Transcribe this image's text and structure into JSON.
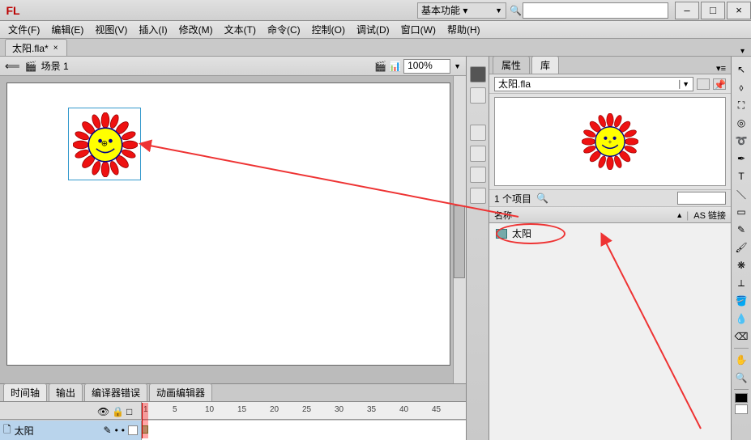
{
  "titlebar": {
    "logo": "FL",
    "workspace": "基本功能 ▾",
    "search_placeholder": "",
    "btn_min": "–",
    "btn_max": "□",
    "btn_close": "×"
  },
  "menu": {
    "file": "文件(F)",
    "edit": "编辑(E)",
    "view": "视图(V)",
    "insert": "插入(I)",
    "modify": "修改(M)",
    "text": "文本(T)",
    "cmd": "命令(C)",
    "control": "控制(O)",
    "debug": "调试(D)",
    "window": "窗口(W)",
    "help": "帮助(H)"
  },
  "document": {
    "tab": "太阳.fla*",
    "scene": "场景 1"
  },
  "zoom": {
    "value": "100%"
  },
  "bottom_tabs": {
    "timeline": "时间轴",
    "output": "输出",
    "compiler": "编译器错误",
    "motion": "动画编辑器"
  },
  "timeline": {
    "layer_name": "太阳",
    "frames": [
      "1",
      "5",
      "10",
      "15",
      "20",
      "25",
      "30",
      "35",
      "40",
      "45"
    ]
  },
  "right_panel": {
    "tab_props": "属性",
    "tab_lib": "库",
    "file_sel": "太阳.fla",
    "item_count": "1 个项目",
    "col_name": "名称",
    "col_link": "AS 链接",
    "item": "太阳"
  },
  "icons": {
    "search": "🔍",
    "back": "⟸",
    "scene": "🎬",
    "eye": "👁",
    "lock": "🔒",
    "outline": "□",
    "pencil": "✎",
    "dot": "•",
    "pin": "📌"
  },
  "tools": [
    "↖",
    "⬚",
    "✥",
    "🔍",
    "✎",
    "T",
    "—",
    "▭",
    "○",
    "✏",
    "🖌",
    "🪣",
    "💧",
    "⟳",
    "✋",
    "🔍"
  ]
}
